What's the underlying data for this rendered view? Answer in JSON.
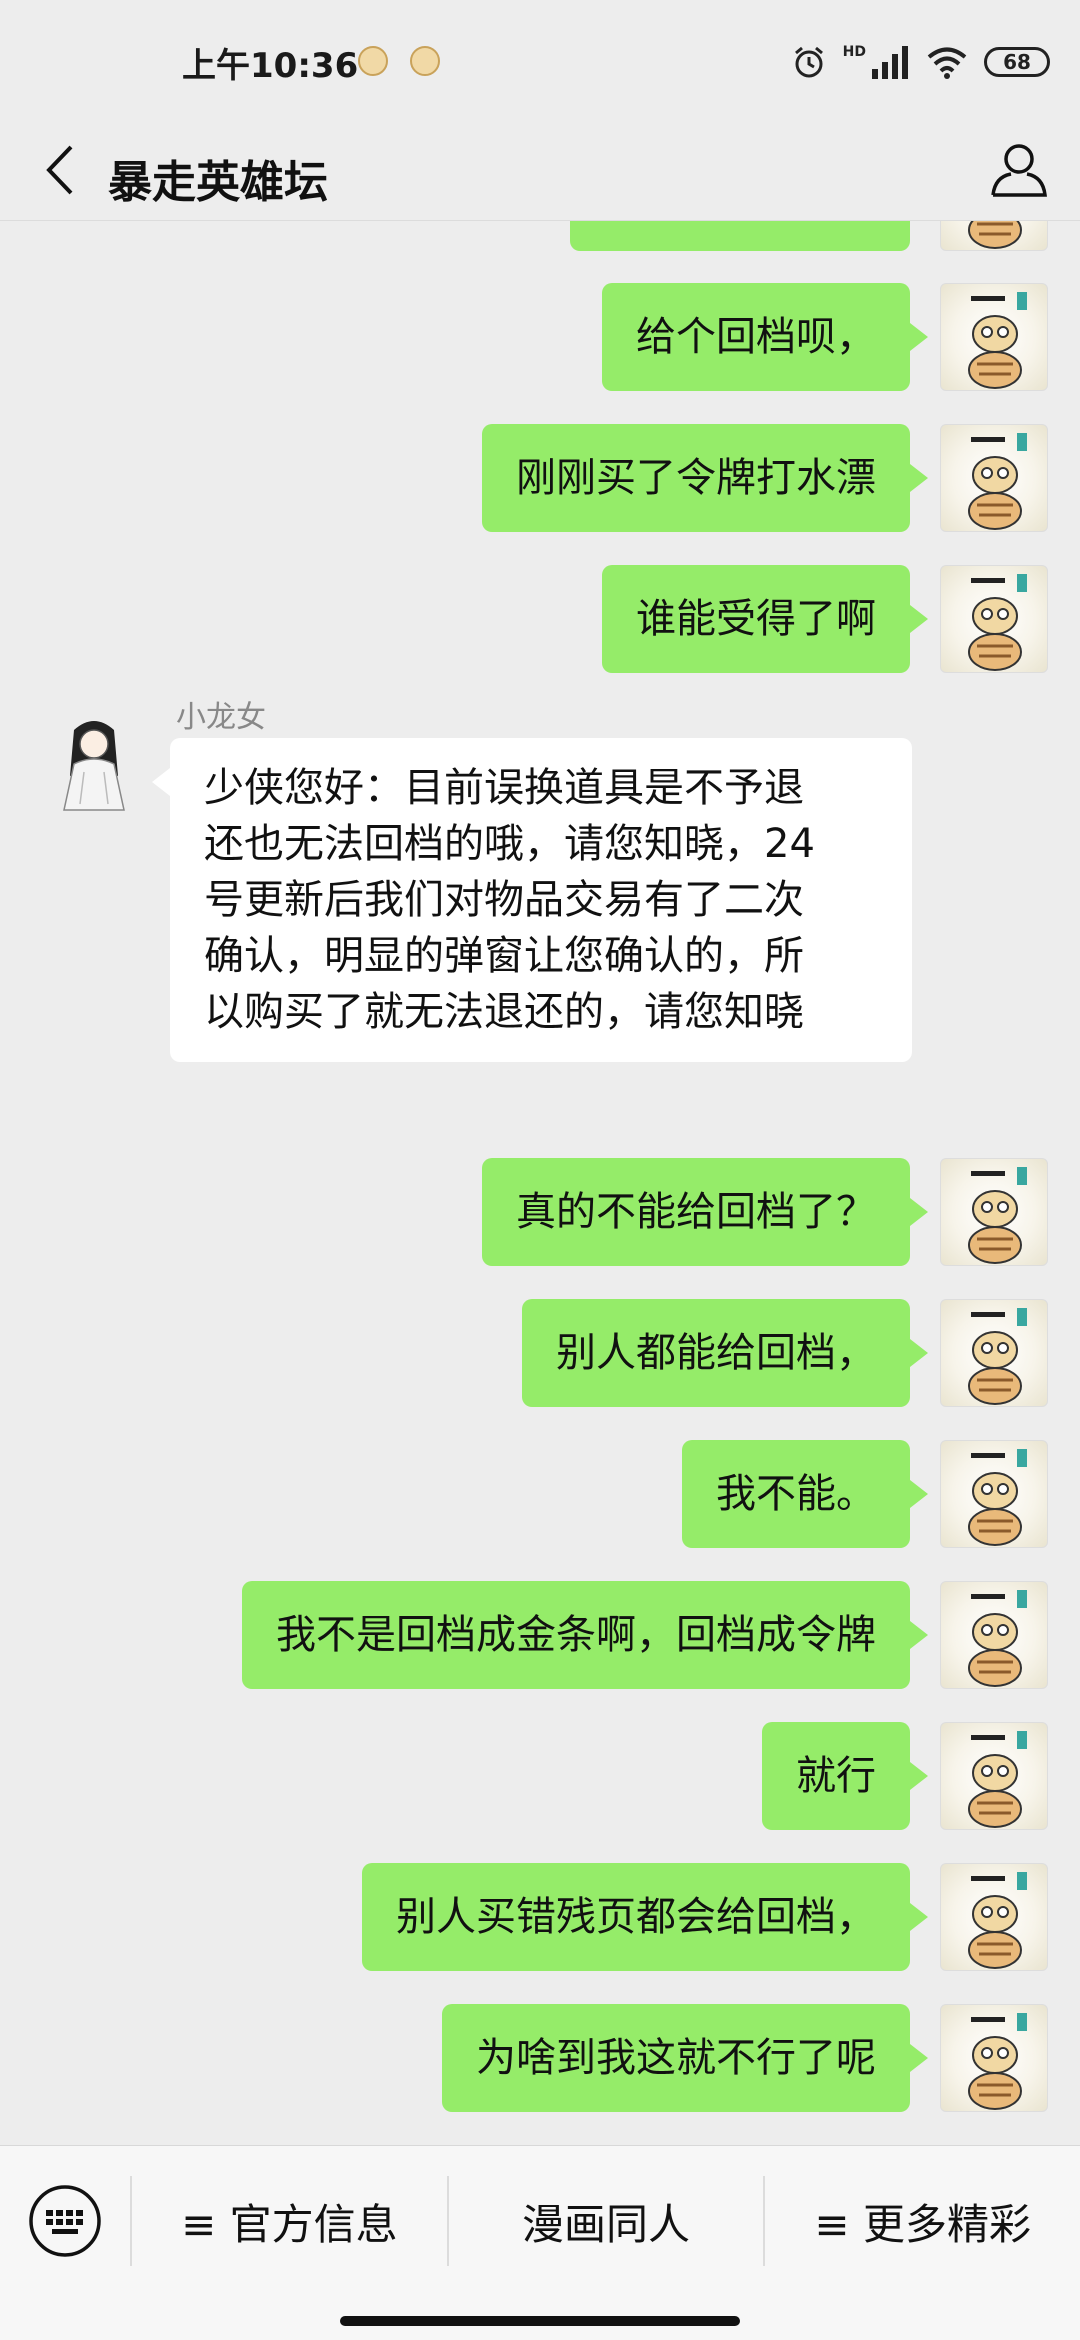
{
  "status": {
    "time": "上午10:36",
    "network": "HD",
    "battery": "68"
  },
  "header": {
    "title": "暴走英雄坛"
  },
  "messages": [
    {
      "from": "me",
      "text": "给个回档呗，"
    },
    {
      "from": "me",
      "text": "刚刚买了令牌打水漂"
    },
    {
      "from": "me",
      "text": "谁能受得了啊"
    },
    {
      "from": "other",
      "sender": "小龙女",
      "lines": [
        "少侠您好：目前误换道具是不予退",
        "还也无法回档的哦，请您知晓，24",
        "号更新后我们对物品交易有了二次",
        "确认，明显的弹窗让您确认的，所",
        "以购买了就无法退还的，请您知晓"
      ]
    },
    {
      "from": "me",
      "text": "真的不能给回档了？"
    },
    {
      "from": "me",
      "text": "别人都能给回档，"
    },
    {
      "from": "me",
      "text": "我不能。"
    },
    {
      "from": "me",
      "text": "我不是回档成金条啊，回档成令牌"
    },
    {
      "from": "me",
      "text": "就行"
    },
    {
      "from": "me",
      "text": "别人买错残页都会给回档，"
    },
    {
      "from": "me",
      "text": "为啥到我这就不行了呢"
    }
  ],
  "bottom_menu": {
    "items": [
      "≡ 官方信息",
      "漫画同人",
      "≡ 更多精彩"
    ]
  },
  "colors": {
    "background": "#ededed",
    "bubble_out": "#95ec69",
    "bubble_in": "#ffffff"
  }
}
